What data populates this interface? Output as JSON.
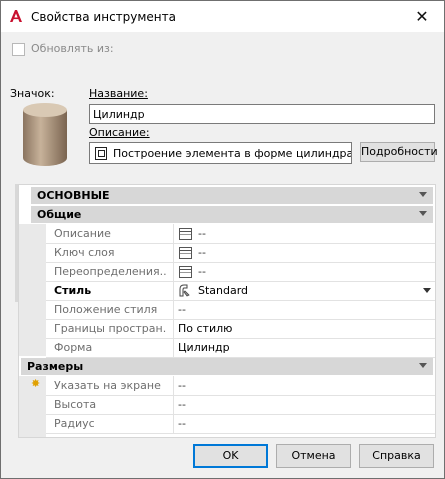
{
  "window": {
    "title": "Свойства инструмента",
    "close_label": "✕"
  },
  "update_from": {
    "label": "Обновлять из:",
    "checked": false
  },
  "icon_label": "Значок:",
  "name": {
    "label": "Название:",
    "value": "Цилиндр"
  },
  "description": {
    "label": "Описание:",
    "value": "Построение элемента в форме цилиндра с",
    "details_button": "Подробности"
  },
  "grid": {
    "main_header": "ОСНОВНЫЕ",
    "general_header": "Общие",
    "general_rows": [
      {
        "key": "Описание",
        "value": "--"
      },
      {
        "key": "Ключ слоя",
        "value": "--"
      },
      {
        "key": "Переопределения...",
        "value": "--"
      },
      {
        "key": "Стиль",
        "value": "Standard"
      },
      {
        "key": "Положение стиля",
        "value": "--"
      },
      {
        "key": "Границы простран...",
        "value": "По стилю"
      },
      {
        "key": "Форма",
        "value": "Цилиндр"
      }
    ],
    "dims_header": "Размеры",
    "dims_rows": [
      {
        "key": "Указать на экране",
        "value": "--"
      },
      {
        "key": "Высота",
        "value": "--"
      },
      {
        "key": "Радиус",
        "value": "--"
      }
    ]
  },
  "buttons": {
    "ok": "OK",
    "cancel": "Отмена",
    "help": "Справка"
  },
  "colors": {
    "accent": "#0078d7",
    "app_red": "#c8102e",
    "header_band": "#d7d7d7"
  }
}
